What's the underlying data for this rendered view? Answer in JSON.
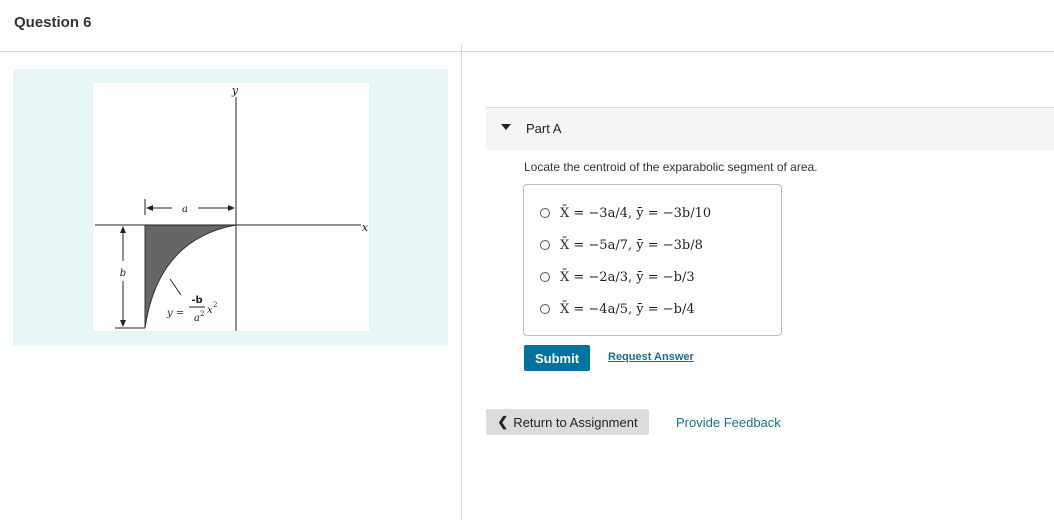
{
  "question": {
    "title": "Question 6"
  },
  "figure": {
    "label_y_axis": "y",
    "label_x_axis": "x",
    "label_a": "a",
    "label_b": "b",
    "equation_lhs": "y =",
    "equation_num": "-b",
    "equation_den": "a",
    "equation_den_exp": "2",
    "equation_var": "x",
    "equation_var_exp": "2"
  },
  "part": {
    "label": "Part A",
    "prompt": "Locate the centroid of the exparabolic segment of area."
  },
  "choices": [
    "X̄ = −3a/4,  ȳ = −3b/10",
    "X̄ = −5a/7,  ȳ = −3b/8",
    "X̄ = −2a/3,  ȳ = −b/3",
    "X̄ = −4a/5,  ȳ = −b/4"
  ],
  "actions": {
    "submit_label": "Submit",
    "request_label": "Request Answer",
    "return_label": "Return to Assignment",
    "return_icon": "chevron-left-icon",
    "feedback_label": "Provide Feedback"
  },
  "colors": {
    "accent": "#00739e",
    "link": "#1a6f8e",
    "figure_bg": "#e6f5f5",
    "shaded_area": "#666666"
  }
}
